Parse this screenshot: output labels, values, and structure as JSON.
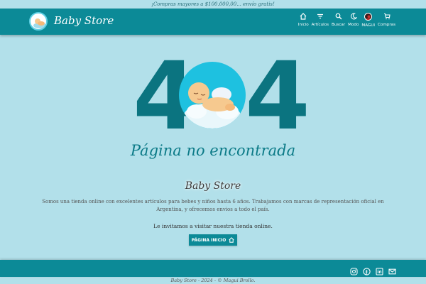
{
  "promo": {
    "text": "¡Compras mayores a $100.000,00... envío gratis!"
  },
  "header": {
    "brand": "Baby Store",
    "nav": [
      {
        "label": "Inicio",
        "icon": "home-icon"
      },
      {
        "label": "Artículos",
        "icon": "filter-icon"
      },
      {
        "label": "Buscar",
        "icon": "search-icon"
      },
      {
        "label": "Modo",
        "icon": "moon-icon"
      },
      {
        "label": "MAGUI",
        "icon": "avatar"
      },
      {
        "label": "Compras",
        "icon": "cart-icon"
      }
    ]
  },
  "error": {
    "code_left": "4",
    "code_right": "4",
    "title": "Página no encontrada"
  },
  "main": {
    "brand": "Baby Store",
    "description": "Somos una tienda online con excelentes artículos para bebes y niños hasta 6 años. Trabajamos con marcas de representación oficial en Argentina, y ofrecemos envios a todo el país.",
    "invite": "Le invitamos a visitar nuestra tienda online.",
    "home_button": "PÁGINA INICIO"
  },
  "footer": {
    "social": [
      "instagram-icon",
      "facebook-icon",
      "linkedin-icon",
      "mail-icon"
    ],
    "copyright": "Baby Store - 2024 - © Magui Brollo."
  },
  "colors": {
    "primary": "#0c8a97",
    "background": "#b2e0ea",
    "digits": "#0b7480",
    "circle": "#1ec1e0"
  }
}
